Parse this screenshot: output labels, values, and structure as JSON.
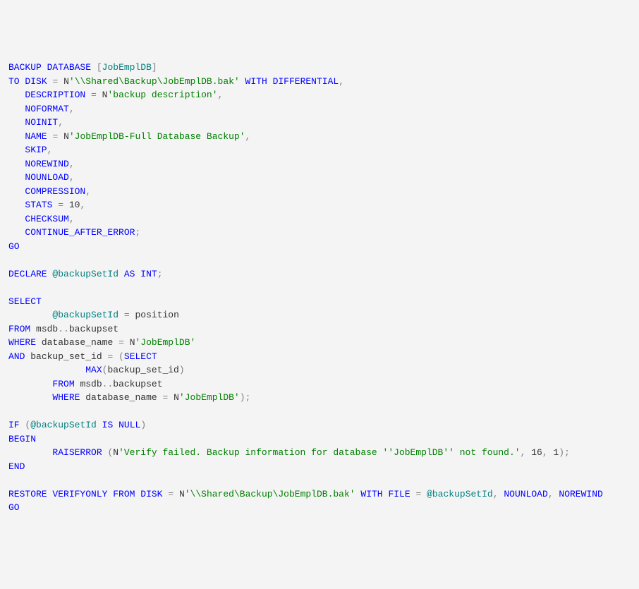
{
  "sql": {
    "line1": {
      "kw1": "BACKUP",
      "kw2": "DATABASE",
      "bracket1": "[",
      "dbname": "JobEmplDB",
      "bracket2": "]"
    },
    "line2": {
      "kw1": "TO",
      "kw2": "DISK",
      "eq": "=",
      "nprefix": "N",
      "str": "'\\\\Shared\\Backup\\JobEmplDB.bak'",
      "kw3": "WITH",
      "kw4": "DIFFERENTIAL",
      "comma": ","
    },
    "line3": {
      "spaces": "   ",
      "kw1": "DESCRIPTION",
      "eq": "=",
      "nprefix": "N",
      "str": "'backup description'",
      "comma": ","
    },
    "line4": {
      "spaces": "   ",
      "kw": "NOFORMAT",
      "comma": ","
    },
    "line5": {
      "spaces": "   ",
      "kw": "NOINIT",
      "comma": ","
    },
    "line6": {
      "spaces": "   ",
      "kw": "NAME",
      "eq": "=",
      "nprefix": "N",
      "str": "'JobEmplDB-Full Database Backup'",
      "comma": ","
    },
    "line7": {
      "spaces": "   ",
      "kw": "SKIP",
      "comma": ","
    },
    "line8": {
      "spaces": "   ",
      "kw": "NOREWIND",
      "comma": ","
    },
    "line9": {
      "spaces": "   ",
      "kw": "NOUNLOAD",
      "comma": ","
    },
    "line10": {
      "spaces": "   ",
      "kw": "COMPRESSION",
      "comma": ","
    },
    "line11": {
      "spaces": "   ",
      "kw": "STATS",
      "eq": "=",
      "num": "10",
      "comma": ","
    },
    "line12": {
      "spaces": "   ",
      "kw": "CHECKSUM",
      "comma": ","
    },
    "line13": {
      "spaces": "   ",
      "kw": "CONTINUE_AFTER_ERROR",
      "semi": ";"
    },
    "go1": "GO",
    "blank1": "",
    "line15": {
      "kw1": "DECLARE",
      "var": "@backupSetId",
      "kw2": "AS",
      "type": "INT",
      "semi": ";"
    },
    "blank2": "",
    "line16": {
      "kw": "SELECT"
    },
    "line17": {
      "spaces": "        ",
      "var": "@backupSetId",
      "eq": "=",
      "col": "position"
    },
    "line18": {
      "kw": "FROM",
      "schema": "msdb",
      "dots": "..",
      "table": "backupset"
    },
    "line19": {
      "kw": "WHERE",
      "col": "database_name",
      "eq": "=",
      "nprefix": "N",
      "str": "'JobEmplDB'"
    },
    "line20": {
      "kw": "AND",
      "col": "backup_set_id",
      "eq": "=",
      "paren1": "(",
      "kw2": "SELECT"
    },
    "line21": {
      "spaces": "              ",
      "func": "MAX",
      "paren1": "(",
      "col": "backup_set_id",
      "paren2": ")"
    },
    "line22": {
      "spaces": "        ",
      "kw": "FROM",
      "schema": "msdb",
      "dots": "..",
      "table": "backupset"
    },
    "line23": {
      "spaces": "        ",
      "kw": "WHERE",
      "col": "database_name",
      "eq": "=",
      "nprefix": "N",
      "str": "'JobEmplDB'",
      "paren": ")",
      "semi": ";"
    },
    "blank3": "",
    "line24": {
      "kw1": "IF",
      "paren1": "(",
      "var": "@backupSetId",
      "kw2": "IS",
      "kw3": "NULL",
      "paren2": ")"
    },
    "line25": {
      "kw": "BEGIN"
    },
    "line26": {
      "spaces": "        ",
      "kw": "RAISERROR",
      "paren1": "(",
      "nprefix": "N",
      "str": "'Verify failed. Backup information for database ''JobEmplDB'' not found.'",
      "comma1": ",",
      "num1": "16",
      "comma2": ",",
      "num2": "1",
      "paren2": ")",
      "semi": ";"
    },
    "line27": {
      "kw": "END"
    },
    "blank4": "",
    "line28": {
      "kw1": "RESTORE",
      "kw2": "VERIFYONLY",
      "kw3": "FROM",
      "kw4": "DISK",
      "eq1": "=",
      "nprefix": "N",
      "str": "'\\\\Shared\\Backup\\JobEmplDB.bak'",
      "kw5": "WITH",
      "kw6": "FILE",
      "eq2": "=",
      "var": "@backupSetId",
      "comma1": ",",
      "kw7": "NOUNLOAD",
      "comma2": ",",
      "kw8": "NOREWIND"
    },
    "go2": "GO"
  }
}
